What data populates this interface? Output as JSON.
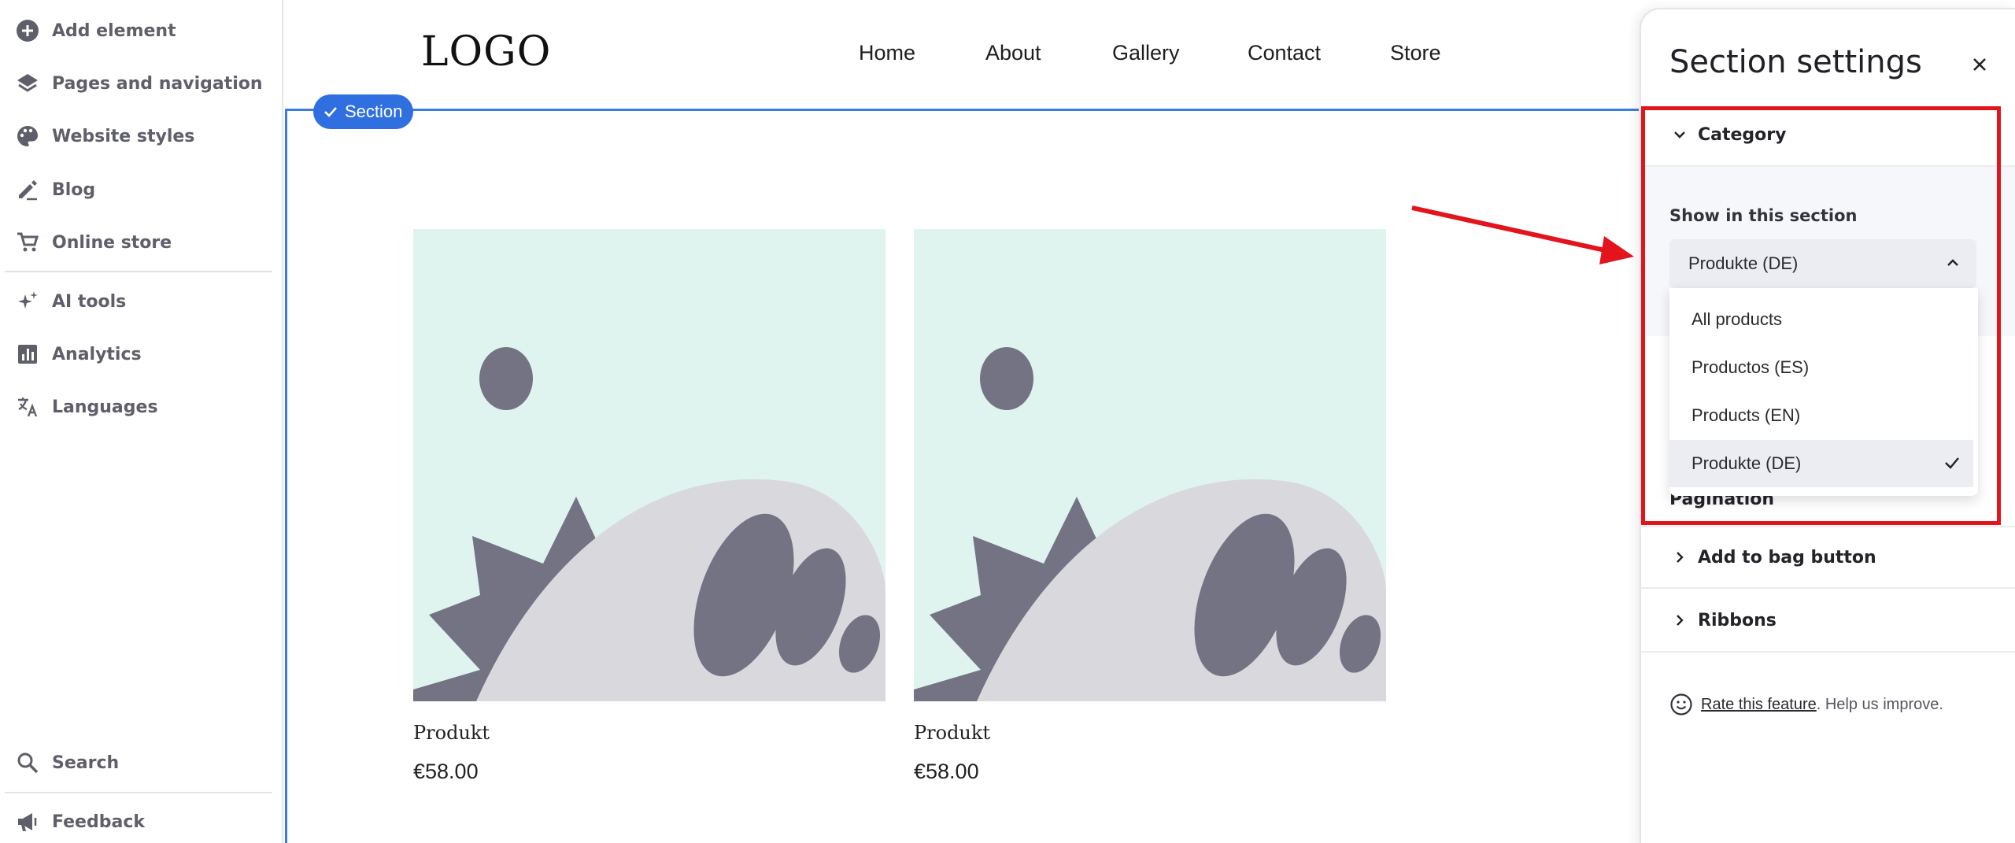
{
  "sidebar": {
    "items": [
      {
        "label": "Add element",
        "icon": "plus-circle-icon"
      },
      {
        "label": "Pages and navigation",
        "icon": "layers-icon"
      },
      {
        "label": "Website styles",
        "icon": "palette-icon"
      },
      {
        "label": "Blog",
        "icon": "pencil-icon"
      },
      {
        "label": "Online store",
        "icon": "cart-icon"
      },
      {
        "label": "AI tools",
        "icon": "sparkle-icon"
      },
      {
        "label": "Analytics",
        "icon": "bar-chart-icon"
      },
      {
        "label": "Languages",
        "icon": "translate-icon"
      }
    ],
    "bottom": [
      {
        "label": "Search",
        "icon": "search-icon"
      },
      {
        "label": "Feedback",
        "icon": "megaphone-icon"
      }
    ]
  },
  "site": {
    "logo": "LOGO",
    "nav": [
      "Home",
      "About",
      "Gallery",
      "Contact",
      "Store"
    ],
    "section_badge": "Section",
    "products": [
      {
        "name": "Produkt",
        "price": "€58.00"
      },
      {
        "name": "Produkt",
        "price": "€58.00"
      }
    ]
  },
  "panel": {
    "title": "Section settings",
    "category_label": "Category",
    "show_label": "Show in this section",
    "selected": "Produkte (DE)",
    "options": [
      "All products",
      "Productos (ES)",
      "Products (EN)",
      "Produkte (DE)"
    ],
    "selected_index": 3,
    "hidden_accordion": "Pagination",
    "accordions": [
      "Add to bag button",
      "Ribbons"
    ],
    "rate_link": "Rate this feature",
    "rate_text": ". Help us improve."
  },
  "colors": {
    "accent": "#2f6fe0",
    "annotation": "#e3141b",
    "image_bg": "#dff3ef",
    "shape_dark": "#737384",
    "shape_light": "#d9d9dd"
  }
}
